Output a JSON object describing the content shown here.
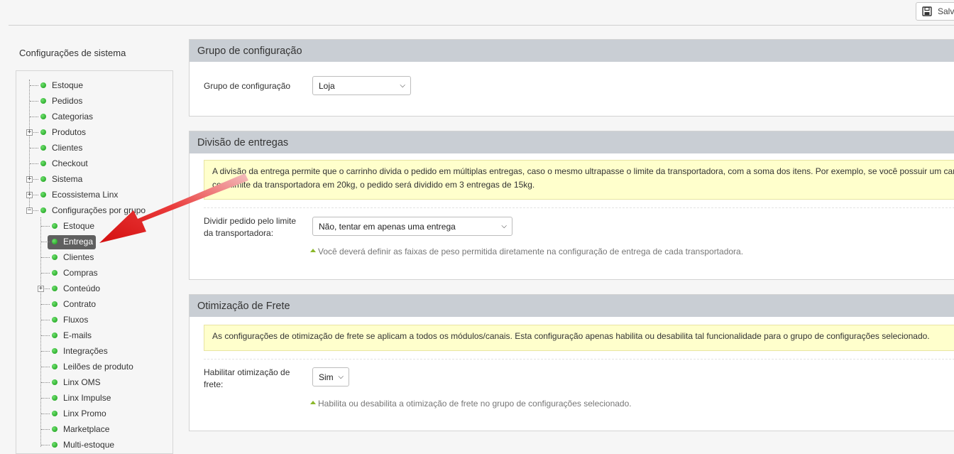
{
  "toolbar": {
    "save_label": "Salvar"
  },
  "sidebar": {
    "title": "Configurações de sistema",
    "items": [
      "Estoque",
      "Pedidos",
      "Categorias",
      "Produtos",
      "Clientes",
      "Checkout",
      "Sistema",
      "Ecossistema Linx",
      "Configurações por grupo"
    ],
    "subitems": [
      "Estoque",
      "Entrega",
      "Clientes",
      "Compras",
      "Conteúdo",
      "Contrato",
      "Fluxos",
      "E-mails",
      "Integrações",
      "Leilões de produto",
      "Linx OMS",
      "Linx Impulse",
      "Linx Promo",
      "Marketplace",
      "Multi-estoque"
    ],
    "selected": "Entrega"
  },
  "group_panel": {
    "title": "Grupo de configuração",
    "field_label": "Grupo de configuração",
    "field_value": "Loja"
  },
  "split_panel": {
    "title": "Divisão de entregas",
    "notice_line1": "A divisão da entrega permite que o carrinho divida o pedido em múltiplas entregas, caso o mesmo ultrapasse o limite da transportadora, com a soma dos itens. Por exemplo, se você possuir um carrinho",
    "notice_line2": "com limite da transportadora em 20kg, o pedido será dividido em 3 entregas de 15kg.",
    "field_label_line1": "Dividir pedido pelo limite",
    "field_label_line2": "da transportadora:",
    "field_value": "Não, tentar em apenas uma entrega",
    "hint": "Você deverá definir as faixas de peso permitida diretamente na configuração de entrega de cada transportadora."
  },
  "freight_panel": {
    "title": "Otimização de Frete",
    "notice": "As configurações de otimização de frete se aplicam a todos os módulos/canais. Esta configuração apenas habilita ou desabilita tal funcionalidade para o grupo de configurações selecionado.",
    "field_label_line1": "Habilitar otimização de",
    "field_label_line2": "frete:",
    "field_value": "Sim",
    "hint": "Habilita ou desabilita a otimização de frete no grupo de configurações selecionado."
  },
  "colors": {
    "accent_arrow": "#e01b1b",
    "dot_green": "#22aa22",
    "notice_bg": "#ffffcc",
    "panel_header": "#c9ced4"
  }
}
